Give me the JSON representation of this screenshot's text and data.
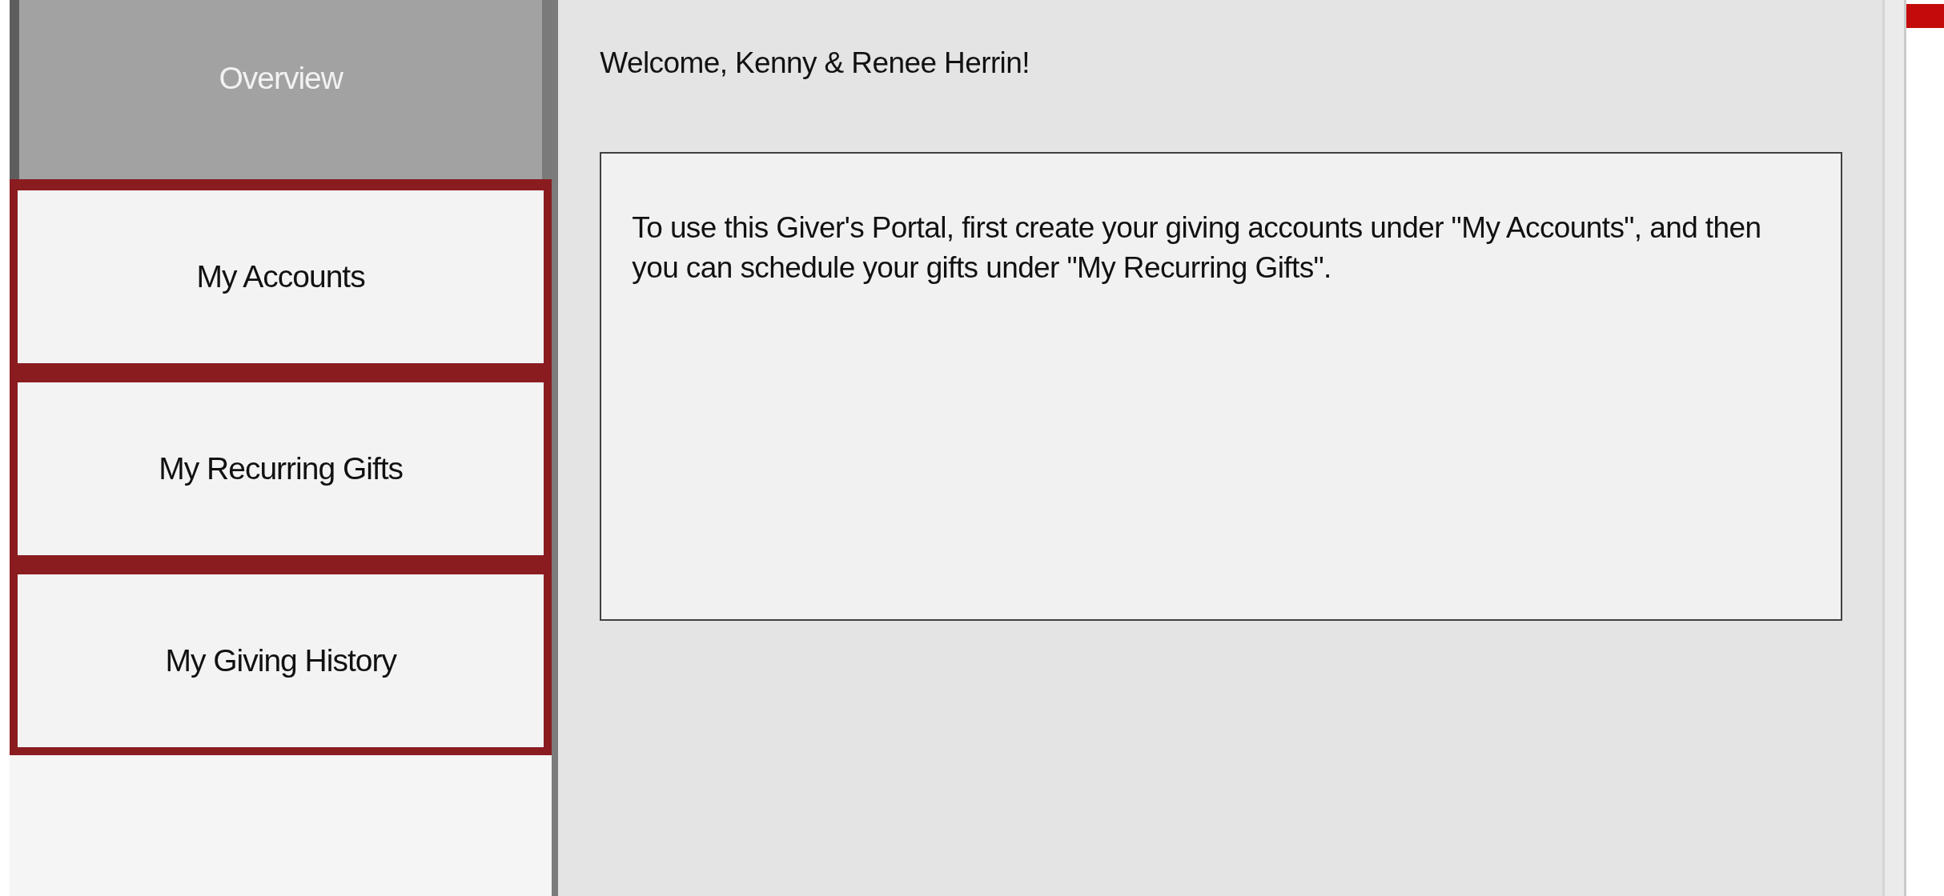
{
  "sidebar": {
    "items": [
      {
        "label": "Overview",
        "selected": true
      },
      {
        "label": "My Accounts",
        "selected": false
      },
      {
        "label": "My Recurring Gifts",
        "selected": false
      },
      {
        "label": "My Giving History",
        "selected": false
      }
    ]
  },
  "main": {
    "welcome": "Welcome, Kenny & Renee Herrin!",
    "message": "To use this Giver's Portal, first create your giving accounts under \"My Accounts\", and then you can schedule your gifts under \"My Recurring Gifts\"."
  }
}
